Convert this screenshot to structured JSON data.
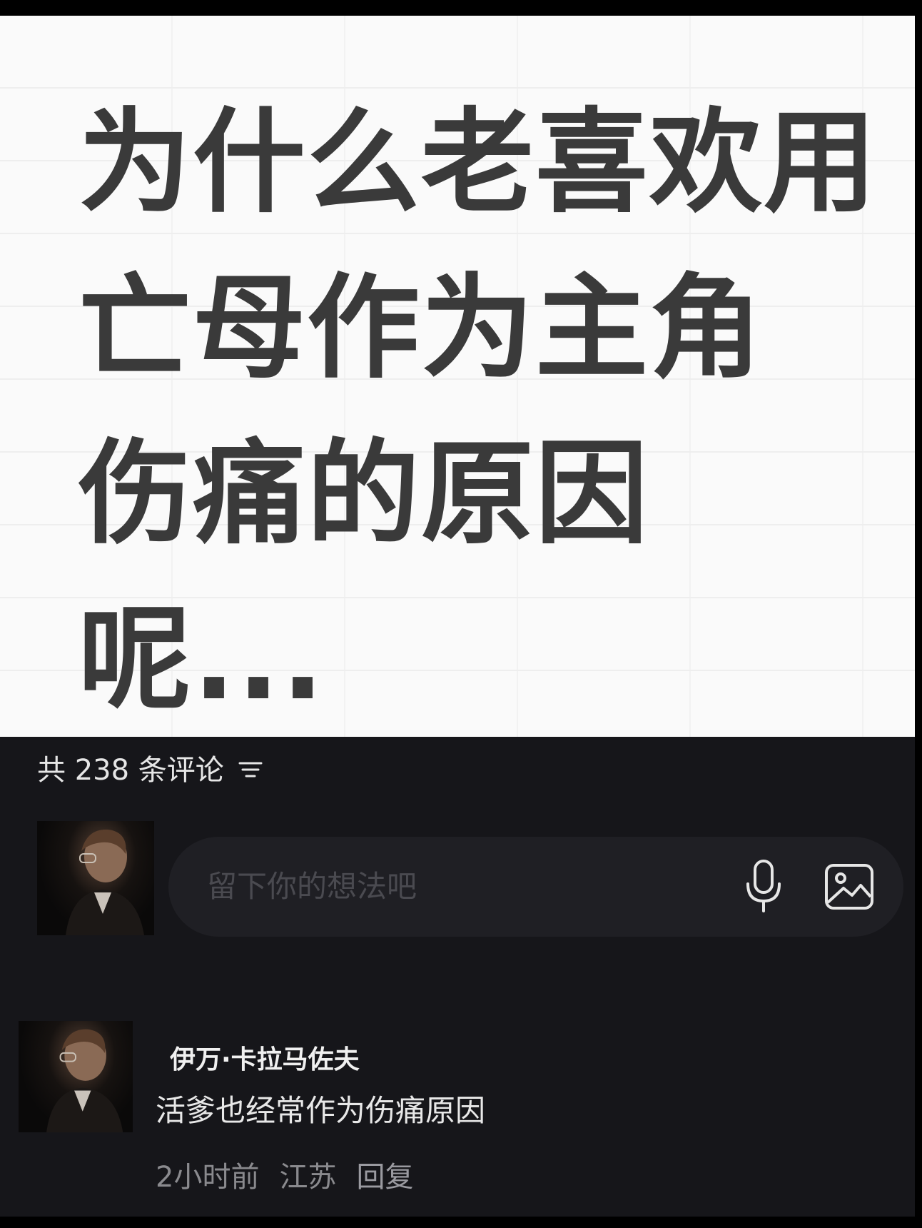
{
  "post": {
    "title": "为什么老喜欢用\n亡母作为主角\n伤痛的原因呢..."
  },
  "comments": {
    "header": "共 238 条评论",
    "sort_icon": "sort-filter-icon",
    "input": {
      "placeholder": "留下你的想法吧",
      "mic_icon": "microphone-icon",
      "image_icon": "image-upload-icon"
    },
    "items": [
      {
        "author": "伊万·卡拉马佐夫",
        "text": "活爹也经常作为伤痛原因",
        "time": "2小时前",
        "location": "江苏",
        "reply_label": "回复"
      }
    ]
  },
  "colors": {
    "panel_bg": "#16161a",
    "input_bg": "#1f1f24",
    "title_text": "#3a3a3a"
  }
}
